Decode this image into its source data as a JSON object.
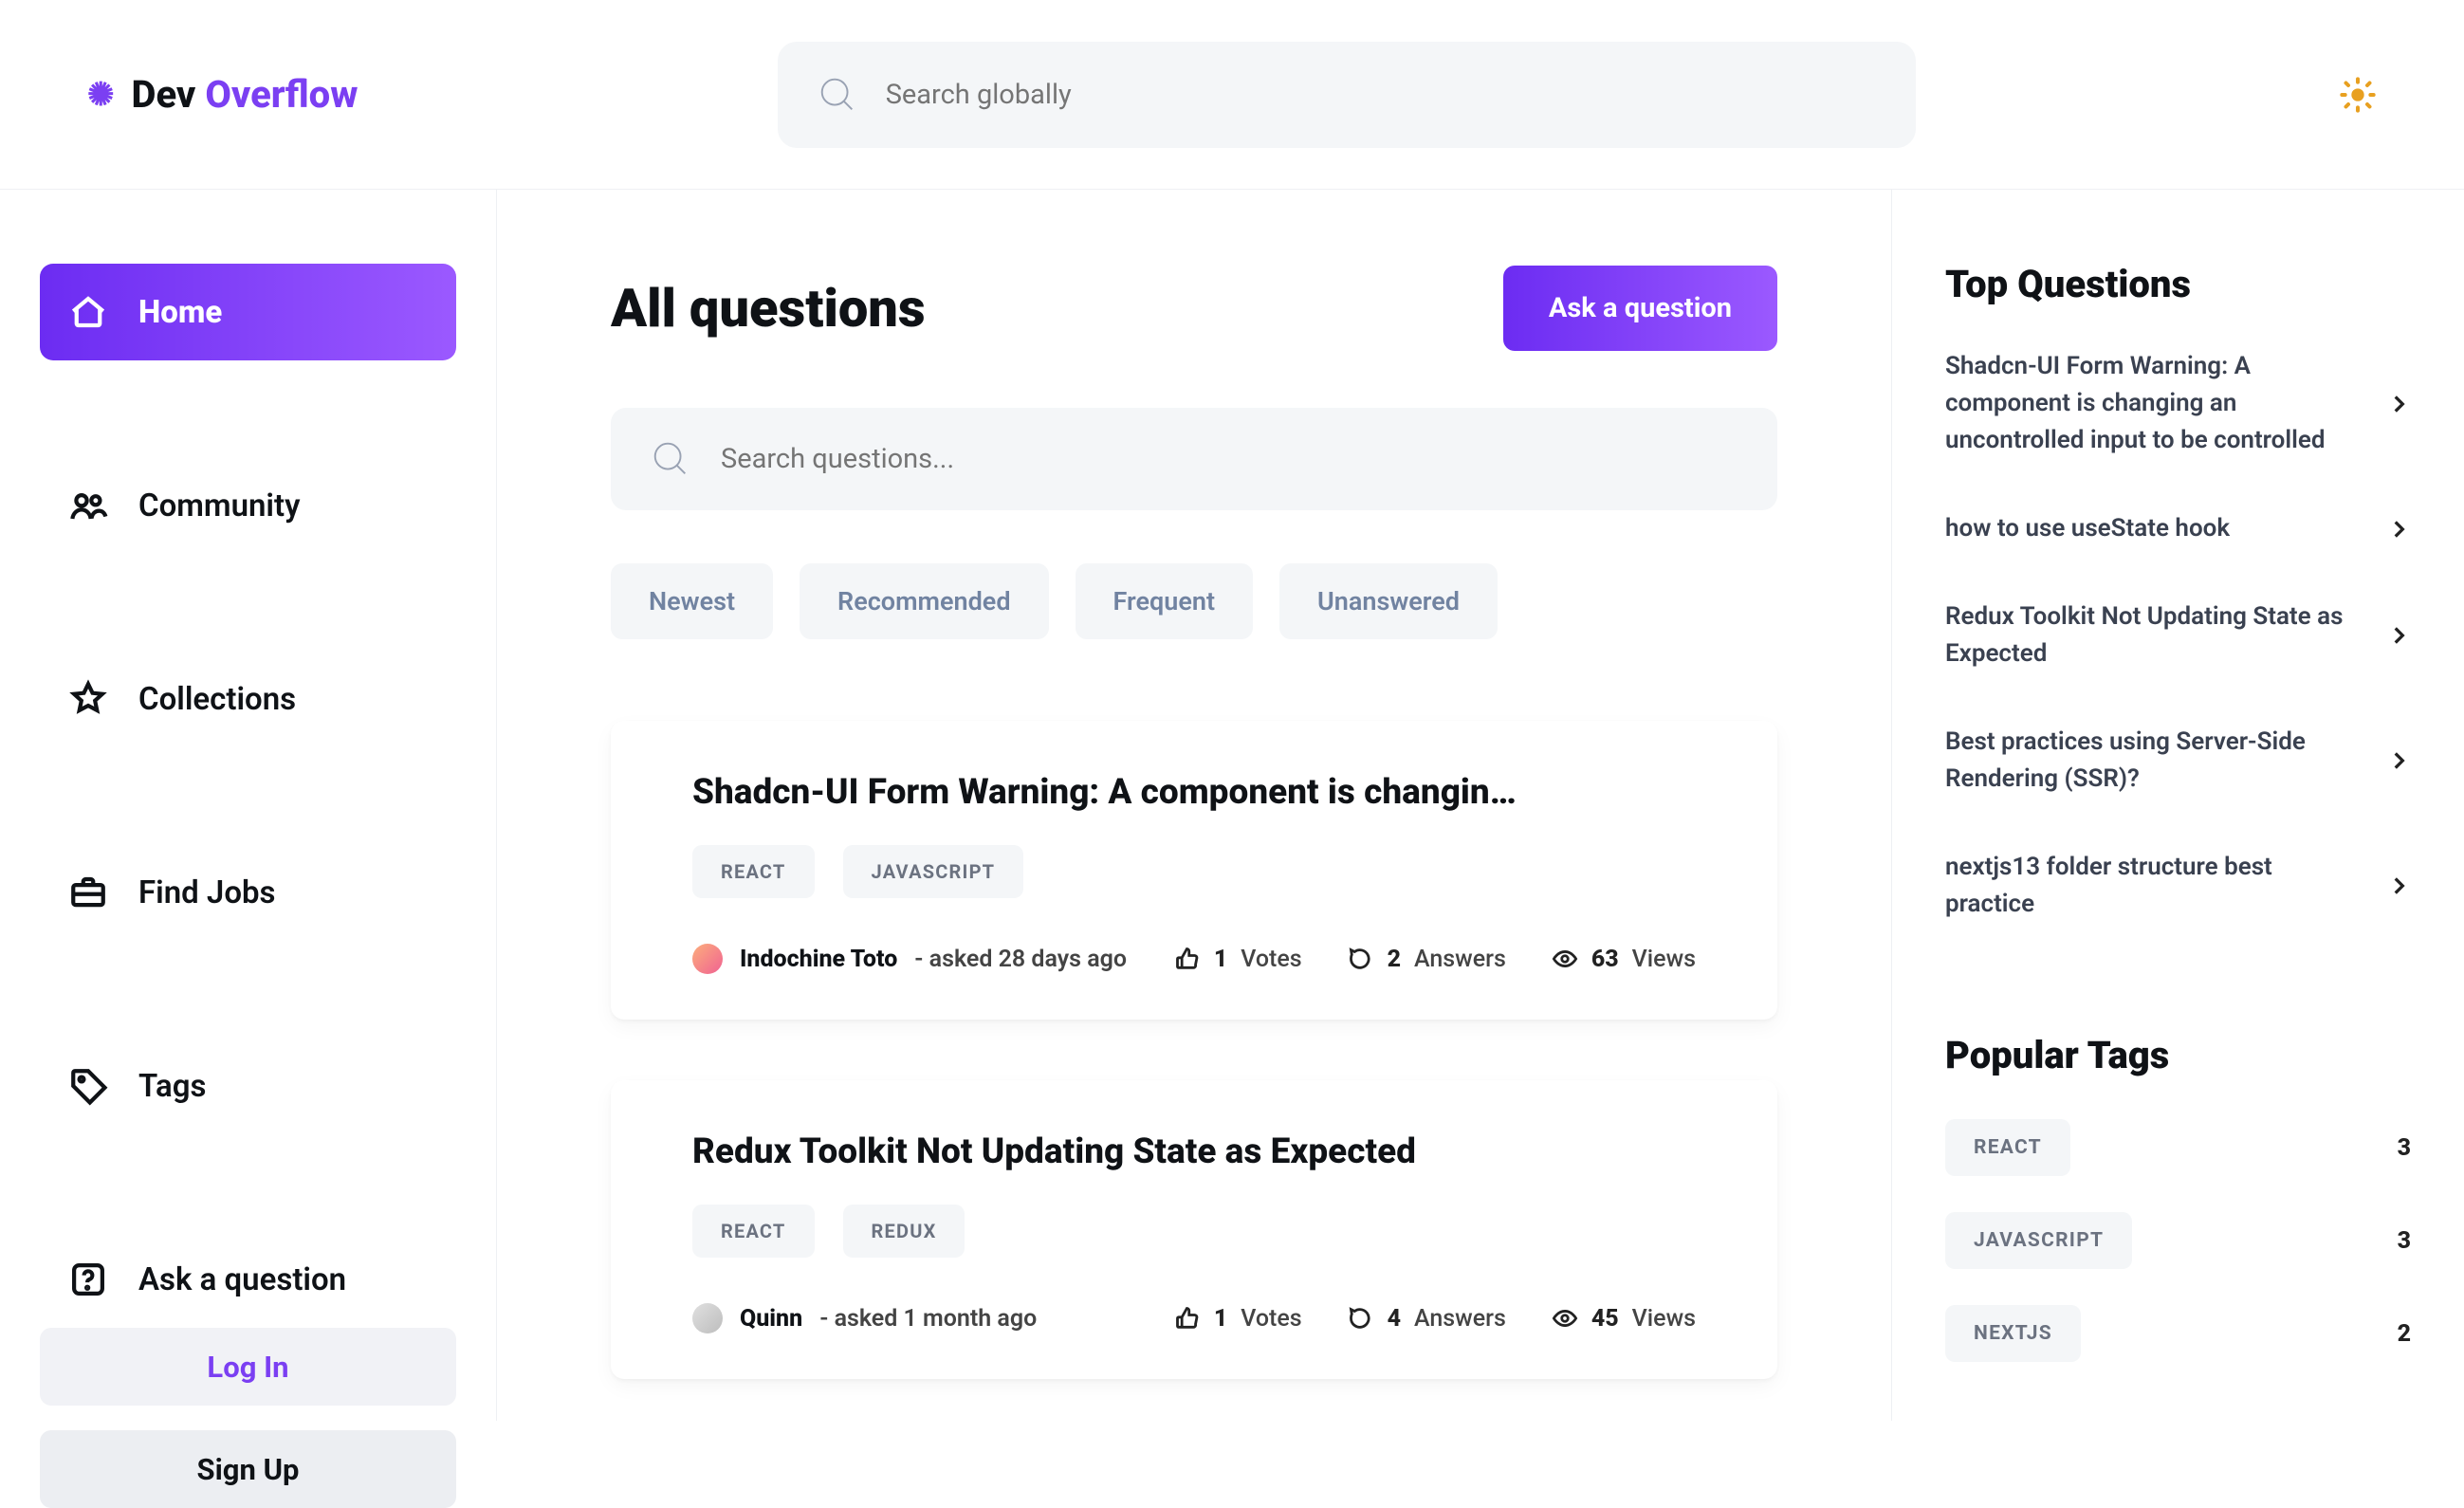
{
  "brand": {
    "prefix": "Dev",
    "accent": "Overflow"
  },
  "search": {
    "global_placeholder": "Search globally",
    "questions_placeholder": "Search questions..."
  },
  "sidebar": {
    "items": [
      {
        "label": "Home"
      },
      {
        "label": "Community"
      },
      {
        "label": "Collections"
      },
      {
        "label": "Find Jobs"
      },
      {
        "label": "Tags"
      },
      {
        "label": "Ask a question"
      }
    ],
    "login": "Log In",
    "signup": "Sign Up"
  },
  "main": {
    "title": "All questions",
    "ask_label": "Ask a question",
    "filters": [
      "Newest",
      "Recommended",
      "Frequent",
      "Unanswered"
    ]
  },
  "questions": [
    {
      "title": "Shadcn-UI Form Warning: A component is changin…",
      "tags": [
        "REACT",
        "JAVASCRIPT"
      ],
      "author": "Indochine Toto",
      "asked": "- asked 28 days ago",
      "votes_n": "1",
      "votes_l": "Votes",
      "answers_n": "2",
      "answers_l": "Answers",
      "views_n": "63",
      "views_l": "Views"
    },
    {
      "title": "Redux Toolkit Not Updating State as Expected",
      "tags": [
        "REACT",
        "REDUX"
      ],
      "author": "Quinn",
      "asked": "- asked 1 month ago",
      "votes_n": "1",
      "votes_l": "Votes",
      "answers_n": "4",
      "answers_l": "Answers",
      "views_n": "45",
      "views_l": "Views"
    }
  ],
  "right": {
    "top_title": "Top Questions",
    "top_questions": [
      "Shadcn-UI Form Warning: A component is changing an uncontrolled input to be controlled",
      "how to use useState hook",
      "Redux Toolkit Not Updating State as Expected",
      "Best practices using Server-Side Rendering (SSR)?",
      "nextjs13 folder structure best practice"
    ],
    "pop_title": "Popular Tags",
    "popular_tags": [
      {
        "name": "REACT",
        "count": "3"
      },
      {
        "name": "JAVASCRIPT",
        "count": "3"
      },
      {
        "name": "NEXTJS",
        "count": "2"
      }
    ]
  }
}
